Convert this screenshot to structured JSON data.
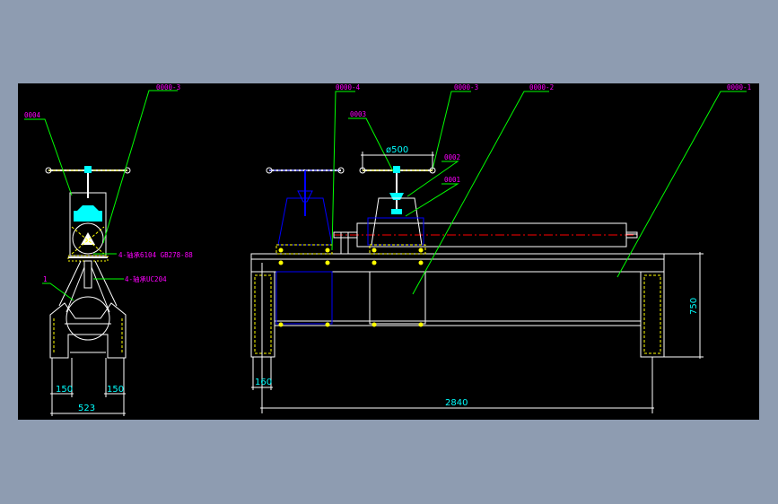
{
  "colors": {
    "background": "#8e9cb1",
    "canvas": "#000000",
    "frame": "#ffffff",
    "leader": "#00ff00",
    "tag": "#ff00ff",
    "dimension": "#00ffff",
    "part": "#ffff00",
    "outline": "#0000ff",
    "center": "#ff0000"
  },
  "callouts": {
    "c1": "0000-3",
    "c2": "0004",
    "c3": "0000-4",
    "c4": "0000-3",
    "c5": "0000-2",
    "c6": "0000-1",
    "c7": "0003",
    "c8": "0002",
    "c9": "0001",
    "c10": "1",
    "c11": "4-轴承6104 GB278-88",
    "c12": "4-轴承UC204"
  },
  "dimensions": {
    "d150_left": "150",
    "d150_right": "150",
    "d523": "523",
    "d160": "160",
    "d2840": "2840",
    "d750": "750",
    "d500": "ø500"
  }
}
